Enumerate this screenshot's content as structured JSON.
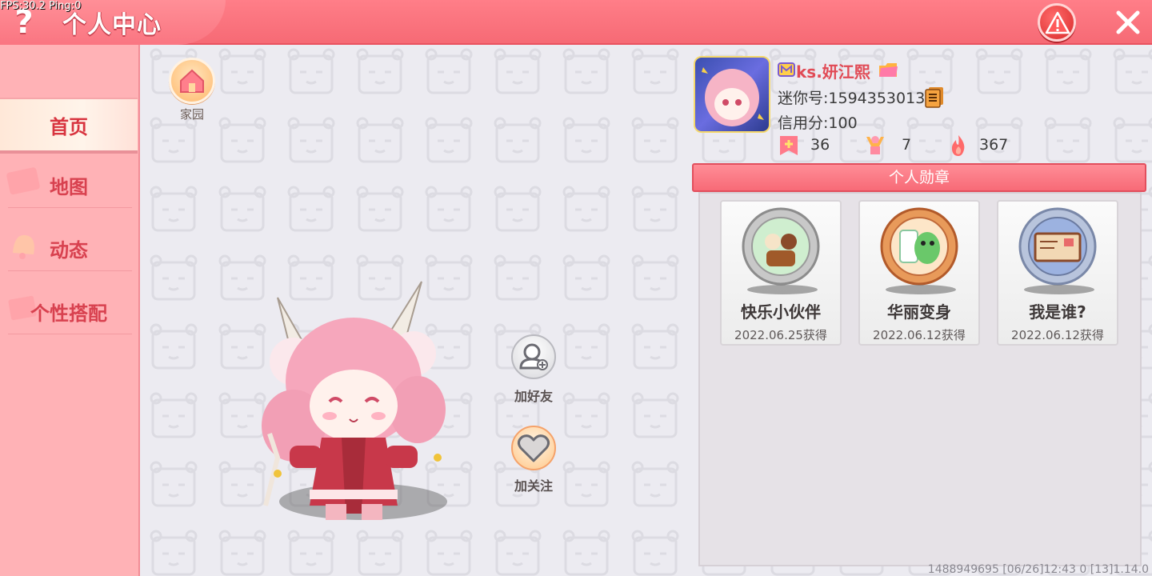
{
  "debug": {
    "fps_text": "FPS:30.2  Ping:0"
  },
  "header": {
    "title": "个人中心",
    "help_symbol": "?"
  },
  "sidebar": {
    "items": [
      {
        "label": "首页",
        "active": true
      },
      {
        "label": "地图",
        "active": false
      },
      {
        "label": "动态",
        "active": false
      },
      {
        "label": "个性搭配",
        "active": false
      }
    ]
  },
  "main": {
    "home_label": "家园",
    "add_friend_label": "加好友",
    "follow_label": "加关注"
  },
  "profile": {
    "username": "ks.妍江熙",
    "mini_id": "迷你号:1594353013",
    "credit": "信用分:100",
    "stats": [
      {
        "icon": "flag-plus-icon",
        "value": "36"
      },
      {
        "icon": "cheer-icon",
        "value": "7"
      },
      {
        "icon": "flame-icon",
        "value": "367"
      }
    ]
  },
  "medals": {
    "title": "个人勋章",
    "items": [
      {
        "name": "快乐小伙伴",
        "date": "2022.06.25获得",
        "tier": "silver"
      },
      {
        "name": "华丽变身",
        "date": "2022.06.12获得",
        "tier": "bronze"
      },
      {
        "name": "我是谁?",
        "date": "2022.06.12获得",
        "tier": "blue-silver"
      }
    ]
  },
  "footer": {
    "info": "1488949695    [06/26]12:43 0   [13]1.14.0"
  },
  "colors": {
    "header": "#f66a75",
    "sidebar": "#ffb2b6",
    "accent": "#d8414f"
  }
}
